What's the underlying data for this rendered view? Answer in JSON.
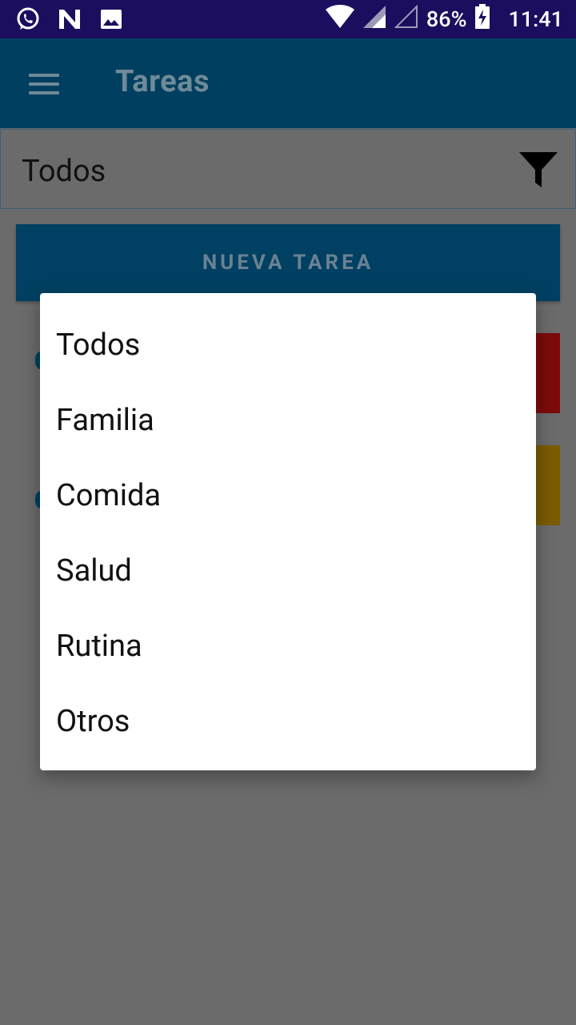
{
  "status_bar": {
    "icons_left": [
      "whatsapp-icon",
      "notification-n-icon",
      "image-icon"
    ],
    "battery": "86%",
    "time": "11:41"
  },
  "app_bar": {
    "title": "Tareas",
    "menu_icon": "hamburger-menu-icon"
  },
  "filter": {
    "selected": "Todos",
    "icon": "filter-icon"
  },
  "new_task_button": "NUEVA TAREA",
  "dropdown": {
    "options": [
      "Todos",
      "Familia",
      "Comida",
      "Salud",
      "Rutina",
      "Otros"
    ]
  },
  "colors": {
    "status_bar": "#1c0e5e",
    "app_bar": "#003f60",
    "scrim": "#6b6b6b",
    "card_red": "#7d0a0a",
    "card_yellow": "#7a5c00"
  }
}
